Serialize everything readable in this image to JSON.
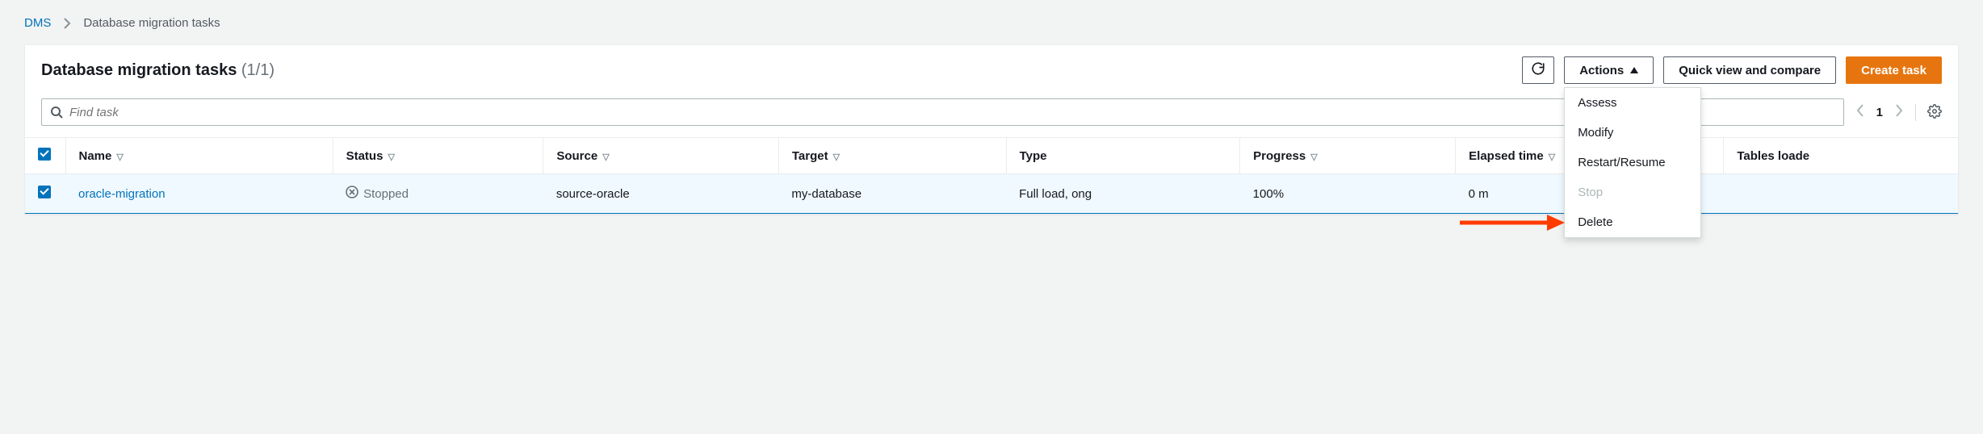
{
  "breadcrumb": {
    "root": "DMS",
    "current": "Database migration tasks"
  },
  "panel": {
    "title": "Database migration tasks",
    "count": "(1/1)"
  },
  "buttons": {
    "actions": "Actions",
    "quick_view": "Quick view and compare",
    "create": "Create task"
  },
  "actions_menu": {
    "assess": "Assess",
    "modify": "Modify",
    "restart": "Restart/Resume",
    "stop": "Stop",
    "delete": "Delete"
  },
  "search": {
    "placeholder": "Find task"
  },
  "pager": {
    "page": "1"
  },
  "columns": {
    "name": "Name",
    "status": "Status",
    "source": "Source",
    "target": "Target",
    "type": "Type",
    "progress": "Progress",
    "elapsed": "Elapsed time",
    "tables": "Tables loade"
  },
  "row": {
    "name": "oracle-migration",
    "status": "Stopped",
    "source": "source-oracle",
    "target": "my-database",
    "type": "Full load, ong",
    "progress": "100%",
    "elapsed": "0 m"
  }
}
